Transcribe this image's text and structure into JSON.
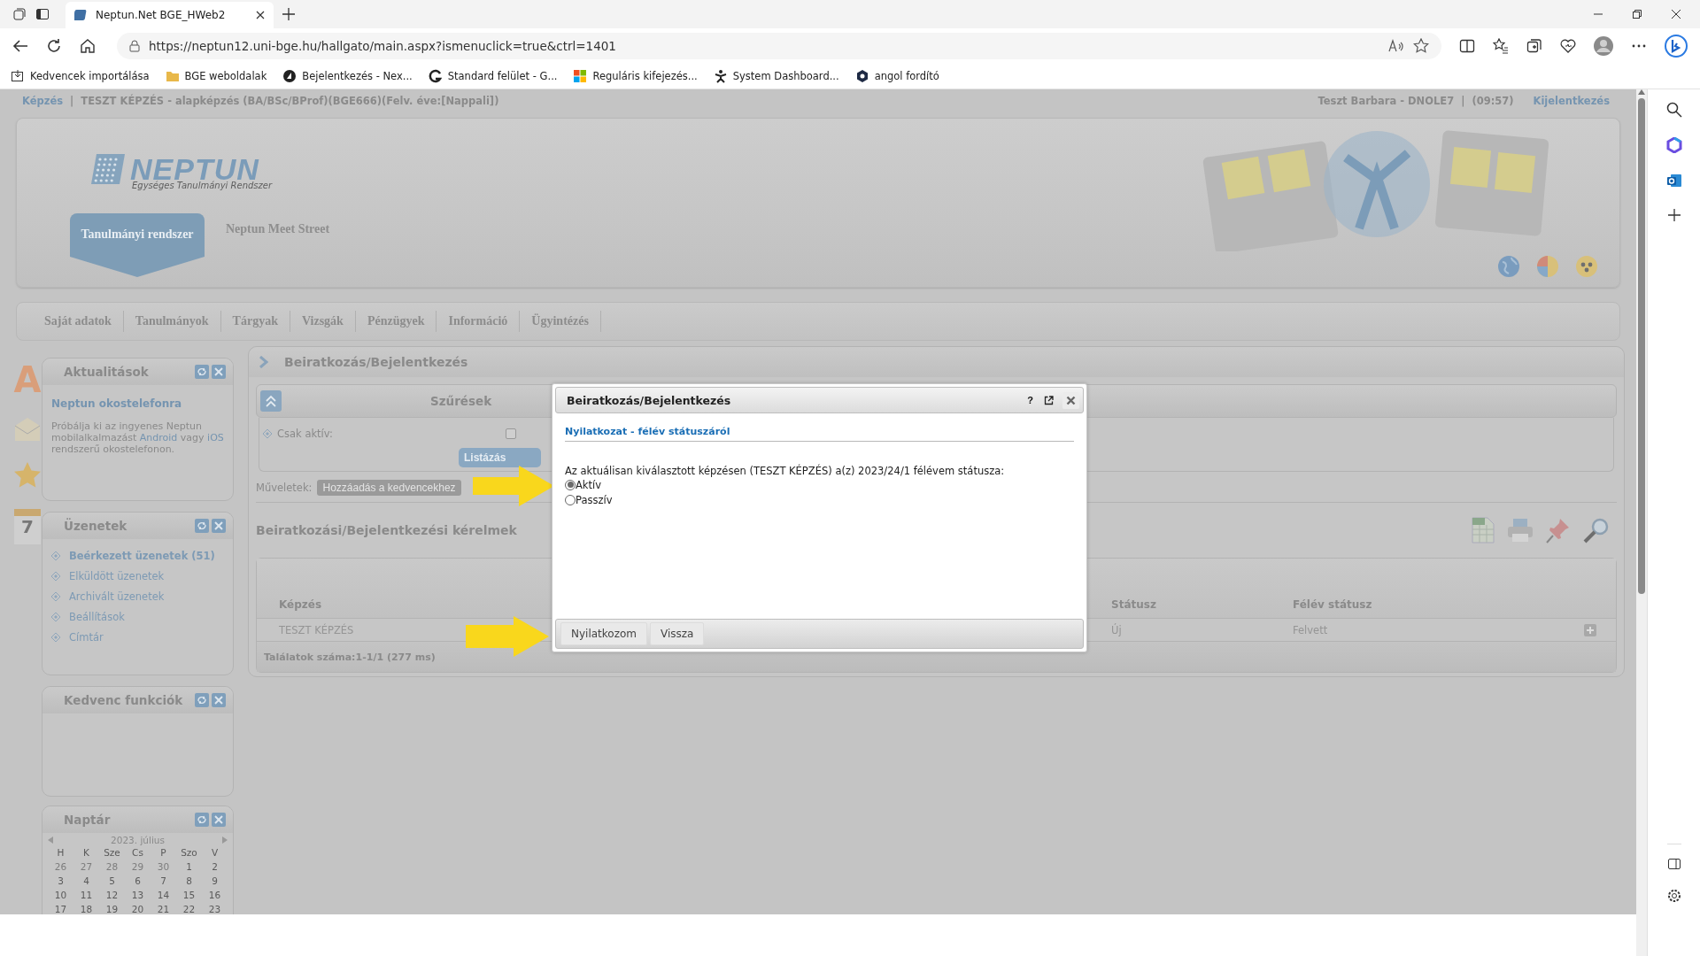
{
  "browser": {
    "tabs": [
      {
        "title": "Neptun.Net BGE_HWeb2",
        "selected": true
      }
    ],
    "url": "https://neptun12.uni-bge.hu/hallgato/main.aspx?ismenuclick=true&ctrl=1401",
    "bookmarks": [
      {
        "kind": "import",
        "label": "Kedvencek importálása"
      },
      {
        "kind": "folder",
        "label": "BGE weboldalak"
      },
      {
        "kind": "disc",
        "label": "Bejelentkezés - Nex..."
      },
      {
        "kind": "arc",
        "label": "Standard felület - G..."
      },
      {
        "kind": "squares",
        "label": "Reguláris kifejezés..."
      },
      {
        "kind": "figure",
        "label": "System Dashboard..."
      },
      {
        "kind": "hexagon",
        "label": "angol fordító"
      }
    ]
  },
  "topline": {
    "training_link": "Képzés",
    "separator": "|",
    "training": "TESZT KÉPZÉS - alapképzés (BA/BSc/BProf)(BGE666)(Felv. éve:[Nappali])",
    "user": "Teszt Barbara - DNOLE7",
    "user_separator": "|",
    "time": "(09:57)",
    "logout": "Kijelentkezés"
  },
  "logo": {
    "name": "NEPTUN",
    "tagline": "Egységes Tanulmányi Rendszer"
  },
  "system_tabs": [
    {
      "label": "Tanulmányi rendszer",
      "selected": true
    },
    {
      "label": "Neptun Meet Street",
      "selected": false
    }
  ],
  "menu": [
    "Saját adatok",
    "Tanulmányok",
    "Tárgyak",
    "Vizsgák",
    "Pénzügyek",
    "Információ",
    "Ügyintézés"
  ],
  "side_icons": {
    "news_letter": "A",
    "calendar_day": "7"
  },
  "news": {
    "title": "Aktualitások",
    "headline": "Neptun okostelefonra",
    "paragraph": [
      {
        "text": "Próbálja ki az ingyenes Neptun mobilalkalmazást ",
        "link": false
      },
      {
        "text": "Android",
        "link": true
      },
      {
        "text": " vagy ",
        "link": false
      },
      {
        "text": "iOS",
        "link": true
      },
      {
        "text": " rendszerű okostelefonon.",
        "link": false
      }
    ]
  },
  "messages": {
    "title": "Üzenetek",
    "items": [
      {
        "label": "Beérkezett üzenetek (51)",
        "selected": true
      },
      {
        "label": "Elküldött üzenetek",
        "selected": false
      },
      {
        "label": "Archivált üzenetek",
        "selected": false
      },
      {
        "label": "Beállítások",
        "selected": false
      },
      {
        "label": "Címtár",
        "selected": false
      }
    ]
  },
  "favorites": {
    "title": "Kedvenc funkciók"
  },
  "calendar": {
    "title": "Naptár",
    "month": "2023. július",
    "weekdays": [
      "H",
      "K",
      "Sze",
      "Cs",
      "P",
      "Szo",
      "V"
    ],
    "weeks": [
      [
        {
          "day": "26",
          "other_month": true
        },
        {
          "day": "27",
          "other_month": true
        },
        {
          "day": "28",
          "other_month": true
        },
        {
          "day": "29",
          "other_month": true
        },
        {
          "day": "30",
          "other_month": true
        },
        {
          "day": "1",
          "other_month": false
        },
        {
          "day": "2",
          "other_month": false
        }
      ],
      [
        {
          "day": "3",
          "other_month": false
        },
        {
          "day": "4",
          "other_month": false
        },
        {
          "day": "5",
          "other_month": false
        },
        {
          "day": "6",
          "other_month": false
        },
        {
          "day": "7",
          "other_month": false
        },
        {
          "day": "8",
          "other_month": false
        },
        {
          "day": "9",
          "other_month": false
        }
      ],
      [
        {
          "day": "10",
          "other_month": false
        },
        {
          "day": "11",
          "other_month": false
        },
        {
          "day": "12",
          "other_month": false
        },
        {
          "day": "13",
          "other_month": false
        },
        {
          "day": "14",
          "other_month": false
        },
        {
          "day": "15",
          "other_month": false
        },
        {
          "day": "16",
          "other_month": false
        }
      ],
      [
        {
          "day": "17",
          "other_month": false
        },
        {
          "day": "18",
          "other_month": false
        },
        {
          "day": "19",
          "other_month": false
        },
        {
          "day": "20",
          "other_month": false
        },
        {
          "day": "21",
          "other_month": false
        },
        {
          "day": "22",
          "other_month": false
        },
        {
          "day": "23",
          "other_month": false
        }
      ]
    ]
  },
  "main": {
    "title": "Beiratkozás/Bejelentkezés",
    "filters": {
      "title": "Szűrések",
      "field_label": "Csak aktív:",
      "checked": false,
      "button": "Listázás"
    },
    "actions": {
      "label": "Műveletek:",
      "button": "Hozzáadás a kedvencekhez"
    },
    "list_title": "Beiratkozási/Bejelentkezési kérelmek",
    "table": {
      "columns": [
        "Képzés",
        "Státusz",
        "Félév státusz"
      ],
      "rows": [
        [
          "TESZT KÉPZÉS",
          "Új",
          "Felvett"
        ]
      ],
      "footer": "Találatok száma:1-1/1 (277 ms)"
    }
  },
  "dialog": {
    "title": "Beiratkozás/Bejelentkezés",
    "help": "?",
    "section": "Nyilatkozat - félév státuszáról",
    "question": "Az aktuálisan kiválasztott képzésen (TESZT KÉPZÉS) a(z) 2023/24/1 félévem státusza:",
    "options": [
      {
        "label": "Aktív",
        "selected": true
      },
      {
        "label": "Passzív",
        "selected": false
      }
    ],
    "buttons": [
      "Nyilatkozom",
      "Vissza"
    ]
  }
}
